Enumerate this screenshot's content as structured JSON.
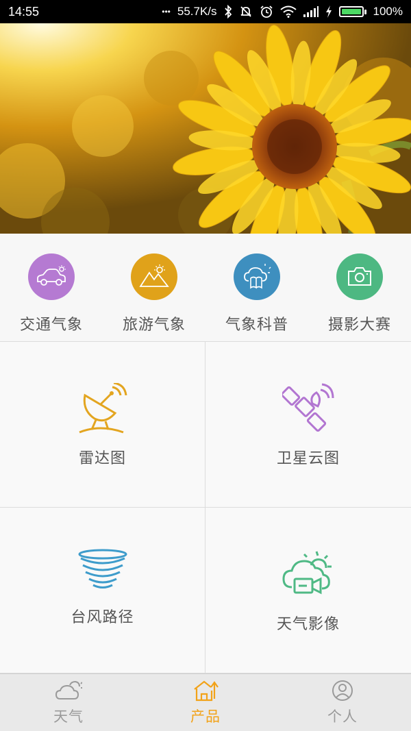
{
  "status_bar": {
    "time": "14:55",
    "dots": "•••",
    "speed": "55.7K/s",
    "battery": "100%",
    "battery_level": 1.0
  },
  "categories": [
    {
      "label": "交通气象",
      "color": "#b57ad2",
      "icon": "car-sun-icon"
    },
    {
      "label": "旅游气象",
      "color": "#e0a21a",
      "icon": "mountain-sun-icon"
    },
    {
      "label": "气象科普",
      "color": "#3e8fbf",
      "icon": "cloud-book-icon"
    },
    {
      "label": "摄影大赛",
      "color": "#4db882",
      "icon": "camera-icon"
    }
  ],
  "tiles": [
    {
      "label": "雷达图",
      "color": "#e3a520",
      "icon": "radar-dish-icon"
    },
    {
      "label": "卫星云图",
      "color": "#b276d1",
      "icon": "satellite-icon"
    },
    {
      "label": "台风路径",
      "color": "#3e9ccb",
      "icon": "typhoon-icon"
    },
    {
      "label": "天气影像",
      "color": "#4fb985",
      "icon": "cloud-camera-icon"
    }
  ],
  "bottom_nav": {
    "items": [
      {
        "label": "天气",
        "icon": "cloud-sun-icon",
        "active": false
      },
      {
        "label": "产品",
        "icon": "home-arrow-icon",
        "active": true
      },
      {
        "label": "个人",
        "icon": "user-icon",
        "active": false
      }
    ],
    "active_color": "#f2a218",
    "inactive_color": "#9a9a9a"
  }
}
